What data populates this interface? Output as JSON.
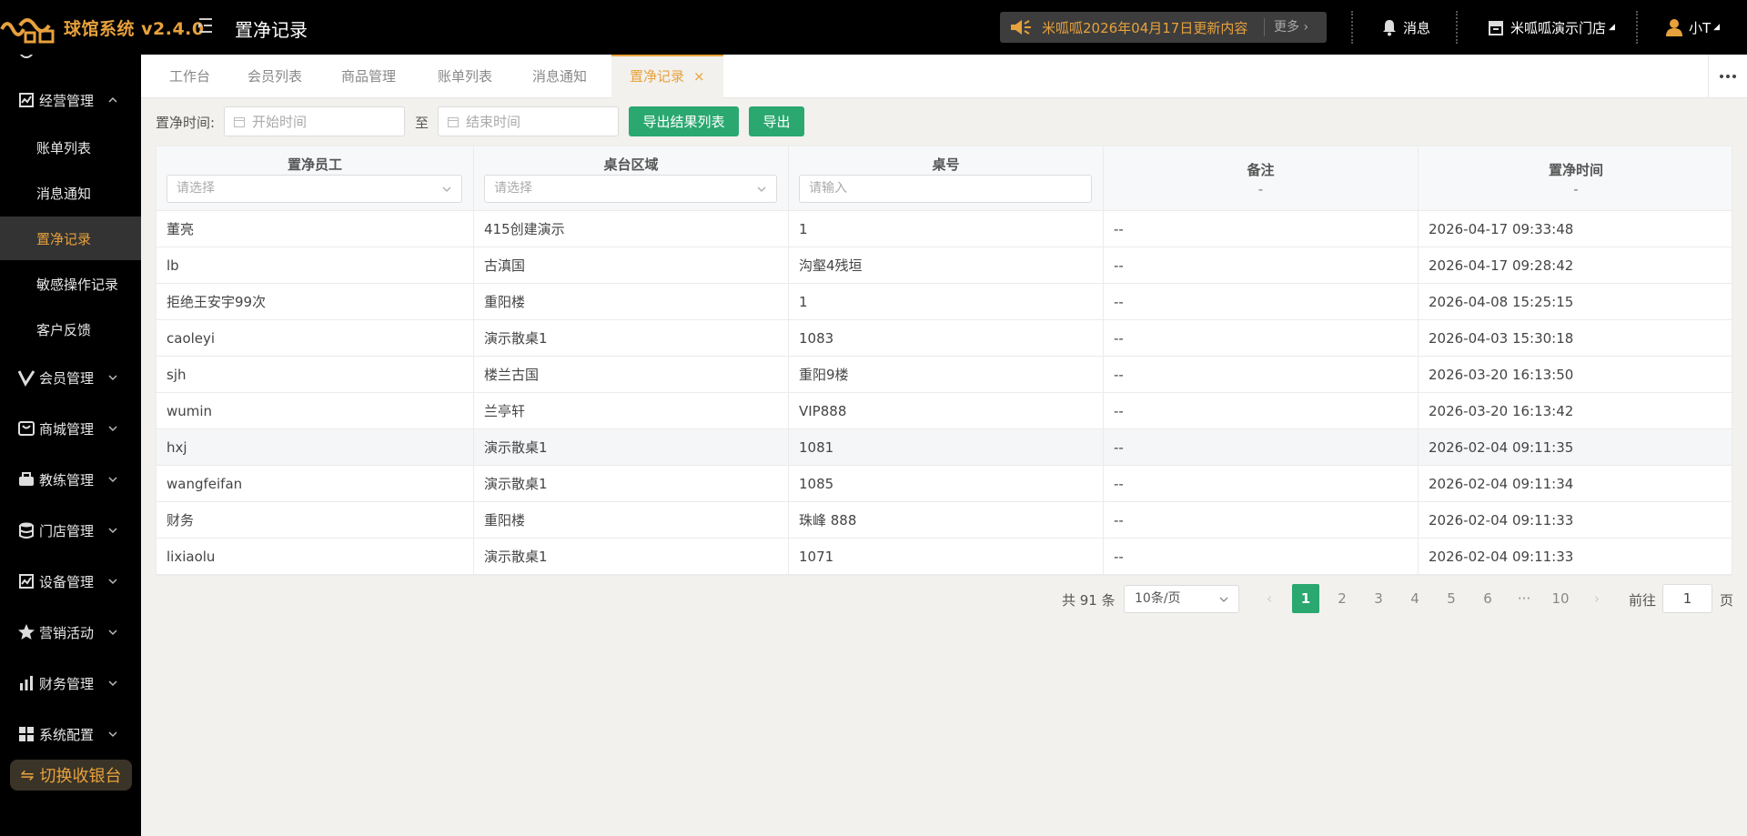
{
  "app": {
    "title": "球馆系统 v2.4.0",
    "page_heading": "置净记录",
    "notice_text": "米呱呱2026年04月17日更新内容",
    "notice_more": "更多",
    "messages_label": "消息",
    "store_label": "米呱呱演示门店",
    "user_label": "小T"
  },
  "sidebar": {
    "groups": [
      {
        "label": "经营管理",
        "icon": "chart-shield-icon",
        "expanded": true
      },
      {
        "label": "会员管理",
        "icon": "v-icon"
      },
      {
        "label": "商城管理",
        "icon": "shop-icon"
      },
      {
        "label": "教练管理",
        "icon": "coach-icon"
      },
      {
        "label": "门店管理",
        "icon": "database-icon"
      },
      {
        "label": "设备管理",
        "icon": "device-icon"
      },
      {
        "label": "营销活动",
        "icon": "star-icon"
      },
      {
        "label": "财务管理",
        "icon": "finance-chart-icon"
      },
      {
        "label": "系统配置",
        "icon": "grid-icon"
      }
    ],
    "sub_items": [
      "账单列表",
      "消息通知",
      "置净记录",
      "敏感操作记录",
      "客户反馈"
    ],
    "active_sub": "置净记录",
    "switch_button": "切换收银台"
  },
  "tabs": [
    "工作台",
    "会员列表",
    "商品管理",
    "账单列表",
    "消息通知",
    "置净记录"
  ],
  "active_tab": "置净记录",
  "filter": {
    "label": "置净时间:",
    "start_placeholder": "开始时间",
    "to_label": "至",
    "end_placeholder": "结束时间",
    "export_list_button": "导出结果列表",
    "export_button": "导出"
  },
  "table": {
    "columns": [
      {
        "title": "置净员工",
        "filter_placeholder": "请选择"
      },
      {
        "title": "桌台区域",
        "filter_placeholder": "请选择"
      },
      {
        "title": "桌号",
        "filter_placeholder": "请输入"
      },
      {
        "title": "备注",
        "filter_placeholder": "-"
      },
      {
        "title": "置净时间",
        "filter_placeholder": "-"
      }
    ],
    "rows": [
      [
        "董亮",
        "415创建演示",
        "1",
        "--",
        "2026-04-17 09:33:48"
      ],
      [
        "lb",
        "古滇国",
        "沟壑4残垣",
        "--",
        "2026-04-17 09:28:42"
      ],
      [
        "拒绝王安宇99次",
        "重阳楼",
        "1",
        "--",
        "2026-04-08 15:25:15"
      ],
      [
        "caoleyi",
        "演示散桌1",
        "1083",
        "--",
        "2026-04-03 15:30:18"
      ],
      [
        "sjh",
        "楼兰古国",
        "重阳9楼",
        "--",
        "2026-03-20 16:13:50"
      ],
      [
        "wumin",
        "兰亭轩",
        "VIP888",
        "--",
        "2026-03-20 16:13:42"
      ],
      [
        "hxj",
        "演示散桌1",
        "1081",
        "--",
        "2026-02-04 09:11:35"
      ],
      [
        "wangfeifan",
        "演示散桌1",
        "1085",
        "--",
        "2026-02-04 09:11:34"
      ],
      [
        "财务",
        "重阳楼",
        "珠峰 888",
        "--",
        "2026-02-04 09:11:33"
      ],
      [
        "lixiaolu",
        "演示散桌1",
        "1071",
        "--",
        "2026-02-04 09:11:33"
      ]
    ],
    "highlighted_row": 6
  },
  "pagination": {
    "total_label": "共 91 条",
    "page_size": "10条/页",
    "pages": [
      "1",
      "2",
      "3",
      "4",
      "5",
      "6",
      "···",
      "10"
    ],
    "current_page": "1",
    "goto_label": "前往",
    "goto_value": "1",
    "goto_suffix": "页"
  },
  "colors": {
    "accent": "#e8a13c",
    "primary_green": "#2aa870",
    "topbar_bg": "#000000",
    "content_bg": "#f2f1ed"
  }
}
